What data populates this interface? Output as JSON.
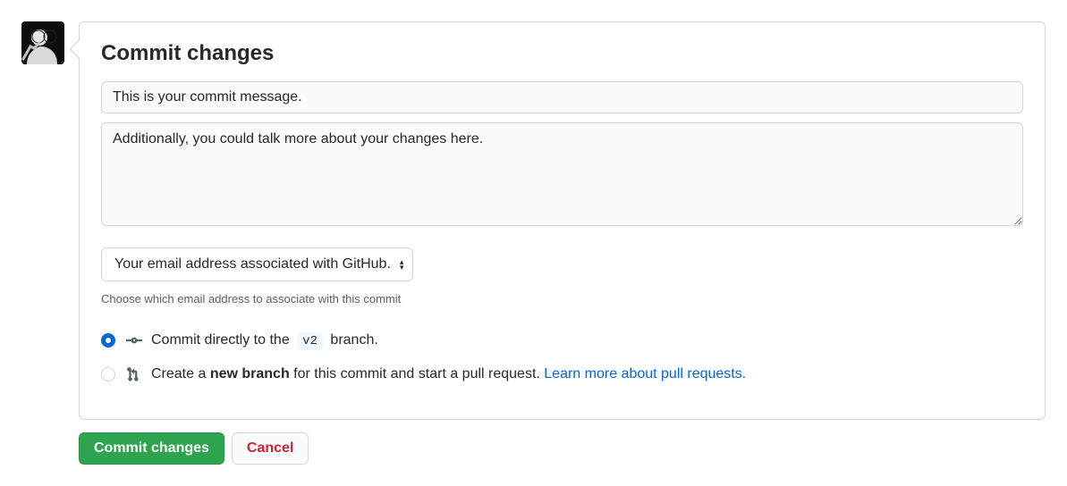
{
  "title": "Commit changes",
  "summary_placeholder": "This is your commit message.",
  "description_placeholder": "Additionally, you could talk more about your changes here.",
  "email_select_label": "Your email address associated with GitHub.",
  "email_helper": "Choose which email address to associate with this commit",
  "radios": {
    "direct": {
      "pre": "Commit directly to the ",
      "branch": "v2",
      "post": " branch."
    },
    "new_branch": {
      "pre": "Create a ",
      "bold": "new branch",
      "post": " for this commit and start a pull request. ",
      "link": "Learn more about pull requests."
    }
  },
  "buttons": {
    "commit": "Commit changes",
    "cancel": "Cancel"
  }
}
